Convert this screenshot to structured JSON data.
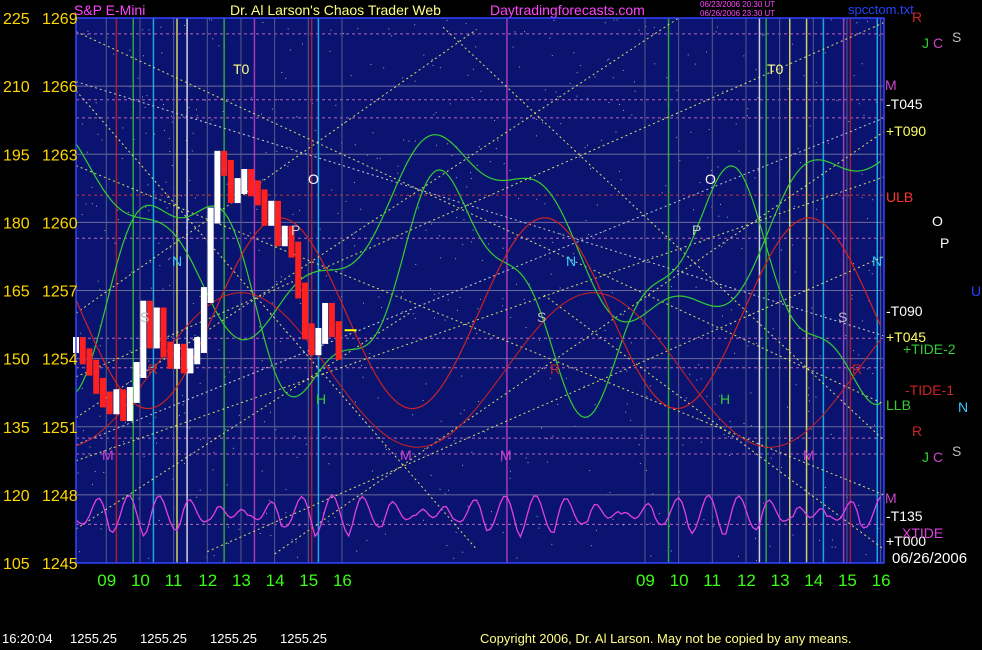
{
  "header": {
    "instrument": "S&P E-Mini",
    "title": "Dr. Al Larson's Chaos Trader Web",
    "site": "Daytradingforecasts.com",
    "stamp1": "06/23/2006 20:30 UT",
    "stamp2": "06/26/2006 23:30 UT",
    "file": "spcctom.txt"
  },
  "footer": {
    "time": "16:20:04",
    "open": "1255.25",
    "high": "1255.25",
    "low": "1255.25",
    "close": "1255.25",
    "copyright": "Copyright 2006, Dr. Al Larson. May not be copied by any means."
  },
  "dates": {
    "left": "06/23",
    "middle": "06/26",
    "right": "06/26/2006"
  },
  "colors": {
    "background": "#000000",
    "plot_bg": "#0a1470",
    "price_up": "#ffffff",
    "price_down": "#ff2020",
    "axis_text": "#ffd700",
    "time_text": "#39ff14",
    "grid_yellow": "#ffff66",
    "tide_green": "#33cc33",
    "tide_red": "#cc2222",
    "xtide": "#e040e0"
  },
  "chart_data": {
    "type": "line",
    "title": "S&P E-Mini",
    "y_left_outer": [
      {
        "label": "225",
        "v": 225
      },
      {
        "label": "210",
        "v": 210
      },
      {
        "label": "195",
        "v": 195
      },
      {
        "label": "180",
        "v": 180
      },
      {
        "label": "165",
        "v": 165
      },
      {
        "label": "150",
        "v": 150
      },
      {
        "label": "135",
        "v": 135
      },
      {
        "label": "120",
        "v": 120
      },
      {
        "label": "105",
        "v": 105
      }
    ],
    "y_price": [
      {
        "label": "1269",
        "v": 1269
      },
      {
        "label": "1266",
        "v": 1266
      },
      {
        "label": "1263",
        "v": 1263
      },
      {
        "label": "1260",
        "v": 1260
      },
      {
        "label": "1257",
        "v": 1257
      },
      {
        "label": "1254",
        "v": 1254
      },
      {
        "label": "1251",
        "v": 1251
      },
      {
        "label": "1248",
        "v": 1248
      },
      {
        "label": "1245",
        "v": 1245
      }
    ],
    "ylim": [
      1245,
      1269
    ],
    "x_ticks": [
      "09",
      "10",
      "11",
      "12",
      "13",
      "14",
      "15",
      "16",
      "09",
      "10",
      "11",
      "12",
      "13",
      "14",
      "15",
      "16"
    ],
    "x_tick_hours": [
      9,
      10,
      11,
      12,
      13,
      14,
      15,
      16,
      25,
      26,
      27,
      28,
      29,
      30,
      31,
      32
    ],
    "xlim_hours": [
      8.1,
      32.1
    ],
    "price_series": {
      "name": "S&P E-Mini",
      "hours": [
        8.1,
        8.3,
        8.5,
        8.7,
        8.9,
        9.1,
        9.3,
        9.5,
        9.7,
        9.9,
        10.1,
        10.3,
        10.5,
        10.7,
        10.9,
        11.1,
        11.3,
        11.5,
        11.7,
        11.9,
        12.1,
        12.3,
        12.5,
        12.7,
        12.9,
        13.1,
        13.3,
        13.5,
        13.7,
        13.9,
        14.1,
        14.3,
        14.5,
        14.7,
        14.9,
        15.1,
        15.3,
        15.5,
        15.7,
        15.9
      ],
      "close": [
        1254.6,
        1254.1,
        1253.6,
        1252.8,
        1252.2,
        1251.9,
        1252.3,
        1251.6,
        1252.4,
        1253.5,
        1256.2,
        1254.8,
        1255.9,
        1254.4,
        1253.9,
        1254.3,
        1253.7,
        1254.1,
        1254.6,
        1256.8,
        1260.3,
        1262.8,
        1262.4,
        1261.2,
        1261.6,
        1262.0,
        1261.5,
        1261.1,
        1260.2,
        1260.6,
        1259.3,
        1259.5,
        1258.8,
        1257.0,
        1255.2,
        1254.5,
        1255.0,
        1256.1,
        1255.3,
        1254.3
      ],
      "last_value": 1255.25
    },
    "cycle_lines": [
      {
        "name": "T0",
        "label": "T0"
      },
      {
        "name": "-T045",
        "label": "-T045"
      },
      {
        "name": "+T090",
        "label": "+T090"
      },
      {
        "name": "-T090",
        "label": "-T090"
      },
      {
        "name": "+T045",
        "label": "+T045"
      },
      {
        "name": "-T135",
        "label": "-T135"
      },
      {
        "name": "+T000",
        "label": "+T000"
      }
    ],
    "tides": [
      {
        "name": "+TIDE-2",
        "label": "+TIDE-2",
        "color": "#33cc33"
      },
      {
        "name": "-TIDE-1",
        "label": "-TIDE-1",
        "color": "#cc2222"
      },
      {
        "name": "XTIDE",
        "label": "XTIDE",
        "color": "#e040e0"
      }
    ],
    "levels": [
      {
        "label": "ULB",
        "color": "#ff3333"
      },
      {
        "label": "LLB",
        "color": "#33cc33"
      }
    ],
    "planet_markers": [
      "M",
      "N",
      "S",
      "P",
      "O",
      "H",
      "R",
      "J",
      "C"
    ],
    "grid": true
  }
}
